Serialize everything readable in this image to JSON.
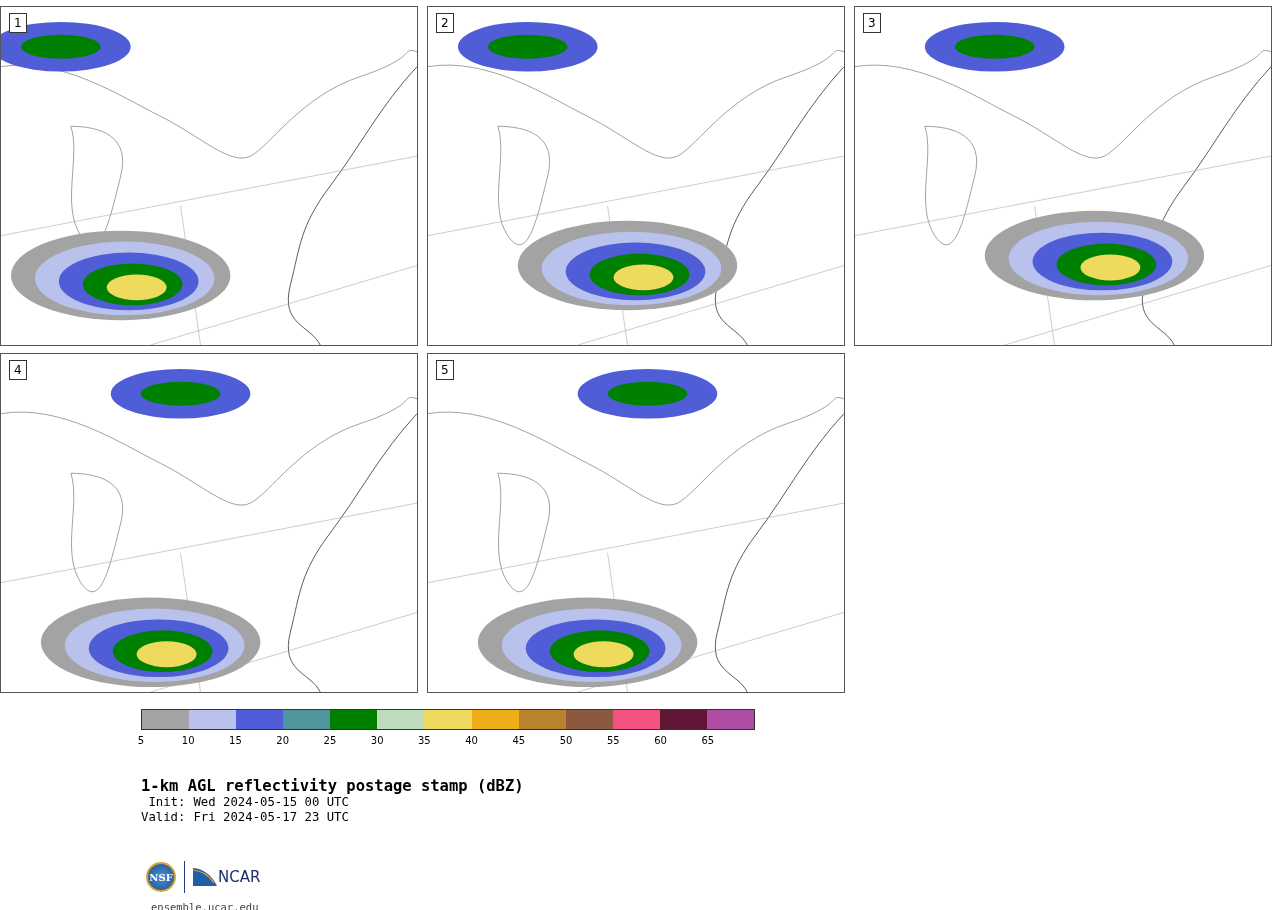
{
  "panels": [
    {
      "number": "1"
    },
    {
      "number": "2"
    },
    {
      "number": "3"
    },
    {
      "number": "4"
    },
    {
      "number": "5"
    }
  ],
  "colorbar": {
    "segments": [
      {
        "color": "#a3a3a3"
      },
      {
        "color": "#b8c2ec"
      },
      {
        "color": "#4f5dd6"
      },
      {
        "color": "#4f959b"
      },
      {
        "color": "#008000"
      },
      {
        "color": "#bedcbc"
      },
      {
        "color": "#eedb5e"
      },
      {
        "color": "#efae17"
      },
      {
        "color": "#b9822e"
      },
      {
        "color": "#8b593d"
      },
      {
        "color": "#f35181"
      },
      {
        "color": "#621636"
      },
      {
        "color": "#ae4ca6"
      }
    ],
    "ticks": [
      "5",
      "10",
      "15",
      "20",
      "25",
      "30",
      "35",
      "40",
      "45",
      "50",
      "55",
      "60",
      "65"
    ]
  },
  "title": "1-km AGL reflectivity postage stamp (dBZ)",
  "times": [
    {
      "label": "Init:",
      "value": "Wed 2024-05-15 00 UTC"
    },
    {
      "label": "Valid:",
      "value": "Fri 2024-05-17 23 UTC"
    }
  ],
  "logos": {
    "left": "NSF",
    "right": "NCAR"
  },
  "site": "ensemble.ucar.edu"
}
